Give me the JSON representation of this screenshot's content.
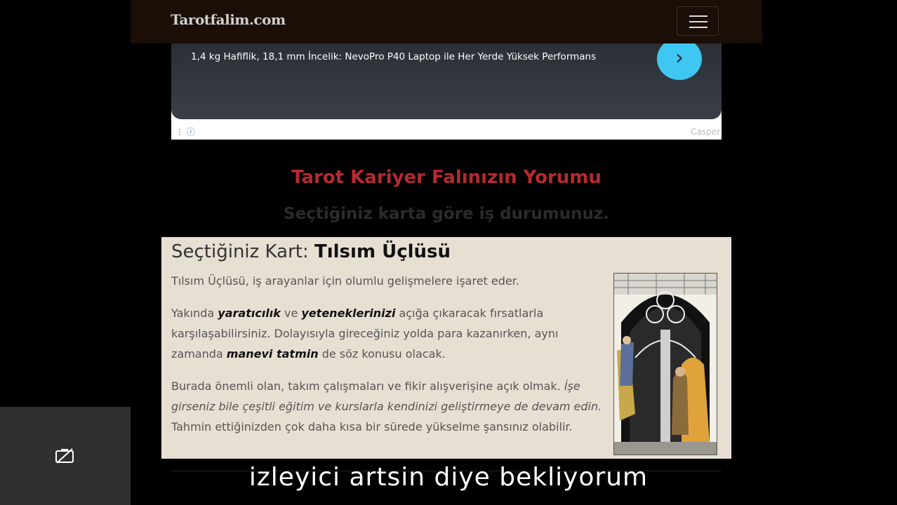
{
  "navbar": {
    "brand": "Tarotfalim.com",
    "menu_icon": "hamburger-menu-icon"
  },
  "ad": {
    "headline": "1,4 kg Hafiflik, 18,1 mm İncelik: NevoPro P40 Laptop ile Her Yerde Yüksek Performans",
    "arrow_glyph": "›",
    "advertiser": "Casper"
  },
  "page": {
    "title": "Tarot Kariyer Falınızın Yorumu",
    "subtitle": "Seçtiğiniz karta göre iş durumunuz."
  },
  "card": {
    "heading_prefix": "Seçtiğiniz Kart: ",
    "card_name": "Tılsım Üçlüsü",
    "p1": "Tılsım Üçlüsü, iş arayanlar için olumlu gelişmelere işaret eder.",
    "p2_a": "Yakında ",
    "p2_b": "yaratıcılık",
    "p2_c": " ve ",
    "p2_d": "yeteneklerinizi",
    "p2_e": " açığa çıkaracak fırsatlarla karşılaşabilirsiniz. Dolayısıyla gireceğiniz yolda para kazanırken, aynı zamanda ",
    "p2_f": "manevi tatmin",
    "p2_g": " de söz konusu olacak.",
    "p3_a": "Burada önemli olan, takım çalışmaları ve fikir alışverişine açık olmak. ",
    "p3_b": "İşe girseniz bile çeşitli eğitim ve kurslarla kendinizi geliştirmeye de devam edin.",
    "p3_c": " Tahmin ettiğinizden çok daha kısa bir sürede yükselme şansınız olabilir.",
    "image_icon": "three-of-pentacles-card-image"
  },
  "overlay": {
    "caption": "izleyici artsin diye bekliyorum",
    "camera_icon": "camera-off-icon"
  },
  "colors": {
    "title": "#b52a2f",
    "card_bg": "#e8dfd3",
    "ad_arrow": "#3fc7f2",
    "navbar": "#1a0e06"
  }
}
